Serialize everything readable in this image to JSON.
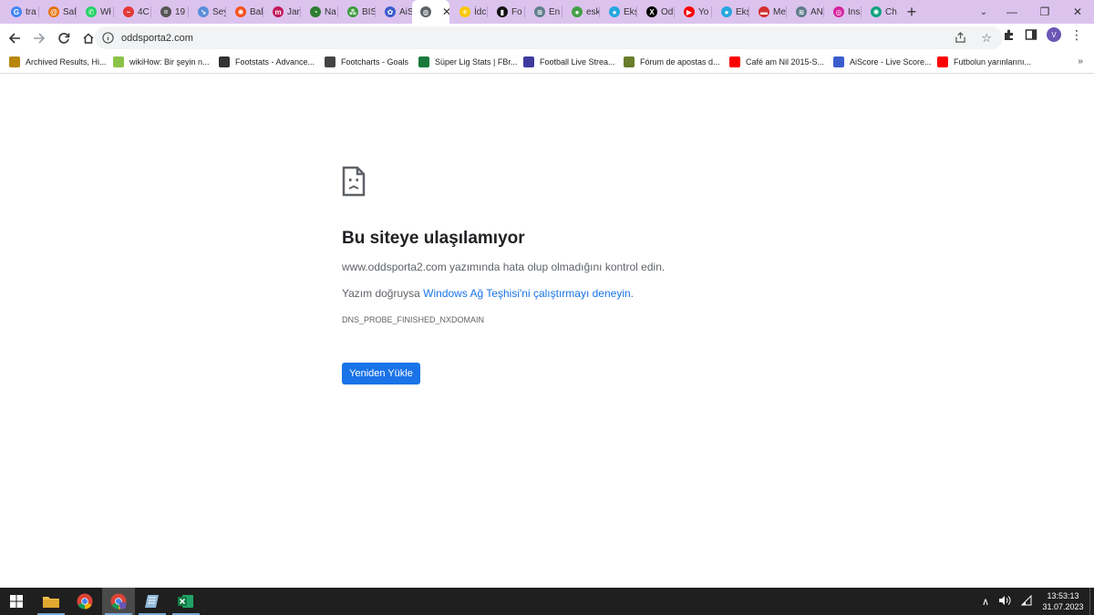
{
  "tabs": [
    {
      "label": "tra",
      "color": "#4285f4",
      "glyph": "G"
    },
    {
      "label": "Sal",
      "color": "#e8710a",
      "glyph": "@"
    },
    {
      "label": "Wł",
      "color": "#25d366",
      "glyph": "✆"
    },
    {
      "label": "4C",
      "color": "#e53935",
      "glyph": "~"
    },
    {
      "label": "19",
      "color": "#555555",
      "glyph": "="
    },
    {
      "label": "Sey",
      "color": "#5a8fd8",
      "glyph": "↘"
    },
    {
      "label": "Bal",
      "color": "#f4511e",
      "glyph": "✺"
    },
    {
      "label": "Jar",
      "color": "#c2185b",
      "glyph": "m"
    },
    {
      "label": "Na",
      "color": "#2e7d32",
      "glyph": "◔"
    },
    {
      "label": "BIS",
      "color": "#3a9a3a",
      "glyph": "⁂"
    },
    {
      "label": "AiS",
      "color": "#3b5ccc",
      "glyph": "✿"
    },
    {
      "label": "",
      "color": "#5f6368",
      "glyph": "◍",
      "active": true
    },
    {
      "label": "İdc",
      "color": "#f9c800",
      "glyph": "⚜"
    },
    {
      "label": "Fo",
      "color": "#111111",
      "glyph": "▮"
    },
    {
      "label": "En",
      "color": "#607d8b",
      "glyph": "≋"
    },
    {
      "label": "esk",
      "color": "#43a047",
      "glyph": "●"
    },
    {
      "label": "Ekş",
      "color": "#26a7de",
      "glyph": "●"
    },
    {
      "label": "Od",
      "color": "#000000",
      "glyph": "X"
    },
    {
      "label": "Yo",
      "color": "#ff0000",
      "glyph": "▶"
    },
    {
      "label": "Ekş",
      "color": "#26a7de",
      "glyph": "●"
    },
    {
      "label": "Me",
      "color": "#d32f2f",
      "glyph": "▬"
    },
    {
      "label": "AN",
      "color": "#607d8b",
      "glyph": "≋"
    },
    {
      "label": "Ins",
      "color": "#d6249f",
      "glyph": "◎"
    },
    {
      "label": "Ch",
      "color": "#10a37f",
      "glyph": "✺"
    }
  ],
  "active_tab_close": "✕",
  "new_tab": "+",
  "window_controls": {
    "tab_search": "⌄",
    "minimize": "—",
    "restore": "❐",
    "close": "✕"
  },
  "address_bar": {
    "url": "oddsporta2.com"
  },
  "bookmarks": [
    {
      "label": "Archived Results, Hi...",
      "color": "#b8860b"
    },
    {
      "label": "wikiHow: Bir şeyin n...",
      "color": "#8bc34a"
    },
    {
      "label": "Footstats - Advance...",
      "color": "#333333"
    },
    {
      "label": "Footcharts - Goals",
      "color": "#444444"
    },
    {
      "label": "Süper Lig Stats | FBr...",
      "color": "#1b7a3a"
    },
    {
      "label": "Football Live Strea...",
      "color": "#3f3a9e"
    },
    {
      "label": "Fórum de apostas d...",
      "color": "#6a7d2a"
    },
    {
      "label": "Café am Nil 2015-S...",
      "color": "#ff0000"
    },
    {
      "label": "AiScore - Live Score...",
      "color": "#3b5ccc"
    },
    {
      "label": "Futbolun yarınlarını...",
      "color": "#ff0000"
    }
  ],
  "bookmarks_more": "»",
  "error": {
    "title": "Bu siteye ulaşılamıyor",
    "line1": "www.oddsporta2.com yazımında hata olup olmadığını kontrol edin.",
    "line2_prefix": "Yazım doğruysa ",
    "line2_link": "Windows Ağ Teşhisi'ni çalıştırmayı deneyin",
    "line2_suffix": ".",
    "code": "DNS_PROBE_FINISHED_NXDOMAIN",
    "reload_label": "Yeniden Yükle"
  },
  "taskbar": {
    "time": "13:53:13",
    "date": "31.07.2023",
    "tray_up": "∧",
    "volume": "🔊"
  },
  "colors": {
    "tabstrip": "#dcc3ee",
    "accent": "#1a73e8",
    "taskbar": "#1f1f1f"
  }
}
